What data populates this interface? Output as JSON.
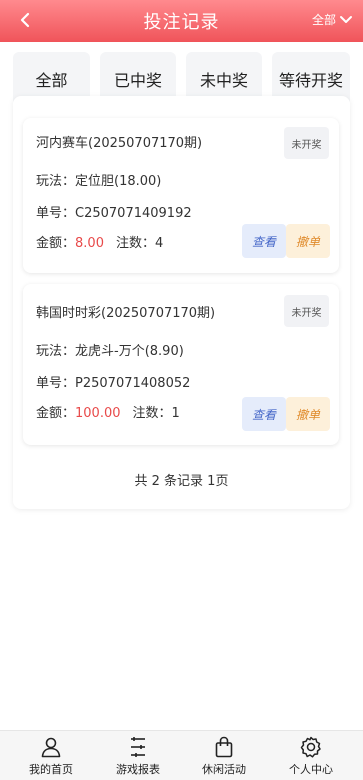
{
  "header": {
    "title": "投注记录",
    "filter_label": "全部"
  },
  "tabs": [
    {
      "label": "全部"
    },
    {
      "label": "已中奖"
    },
    {
      "label": "未中奖"
    },
    {
      "label": "等待开奖"
    }
  ],
  "records": [
    {
      "title": "河内赛车(20250707170期)",
      "status": "未开奖",
      "play_label": "玩法：",
      "play_value": "定位胆(18.00)",
      "order_label": "单号：",
      "order_value": "C2507071409192",
      "amount_label": "金额：",
      "amount_value": "8.00",
      "count_label": "注数：",
      "count_value": "4",
      "view_label": "查看",
      "cancel_label": "撤单"
    },
    {
      "title": "韩国时时彩(20250707170期)",
      "status": "未开奖",
      "play_label": "玩法：",
      "play_value": "龙虎斗-万个(8.90)",
      "order_label": "单号：",
      "order_value": "P2507071408052",
      "amount_label": "金额：",
      "amount_value": "100.00",
      "count_label": "注数：",
      "count_value": "1",
      "view_label": "查看",
      "cancel_label": "撤单"
    }
  ],
  "pager": {
    "text": "共 2 条记录 1页"
  },
  "tabbar": [
    {
      "label": "我的首页",
      "icon": "user-icon"
    },
    {
      "label": "游戏报表",
      "icon": "list-icon"
    },
    {
      "label": "休闲活动",
      "icon": "bag-icon"
    },
    {
      "label": "个人中心",
      "icon": "gear-icon"
    }
  ],
  "colors": {
    "header_top": "#ff8a8e",
    "header_bottom": "#f0545a",
    "amount": "#e84a4a",
    "view_button": "#4466c8",
    "cancel_button": "#e08a2a"
  }
}
